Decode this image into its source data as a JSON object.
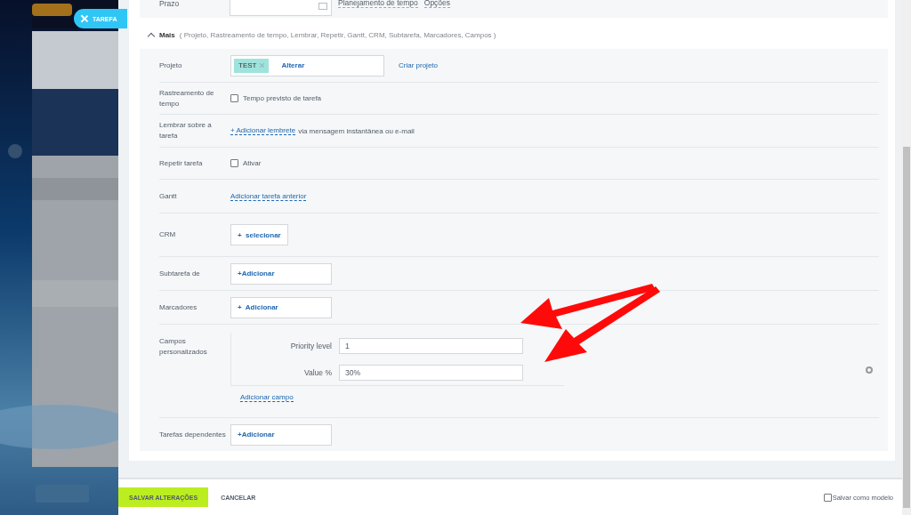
{
  "tab_button": {
    "label": "TAREFA"
  },
  "top_row": {
    "label": "Prazo",
    "links": [
      "Planejamento de tempo",
      "Opções"
    ]
  },
  "more": {
    "label": "Mais",
    "expanded": true,
    "summary": "( Projeto,  Rastreamento de tempo,  Lembrar,  Repetir,  Gantt,  CRM,  Subtarefa,  Marcadores,  Campos )"
  },
  "rows": [
    {
      "kind": "project",
      "label": "Projeto",
      "tag": "TEST",
      "action": "Alterar",
      "link": "Criar projeto"
    },
    {
      "kind": "checkbox",
      "label": "Rastreamento de tempo",
      "option": "Tempo previsto de tarefa",
      "checked": false
    },
    {
      "kind": "reminder",
      "label": "Lembrar sobre a tarefa",
      "link": "+ Adicionar lembrete",
      "text": "via mensagem instantânea ou e-mail"
    },
    {
      "kind": "checkbox",
      "label": "Repetir tarefa",
      "option": "Ativar",
      "checked": false
    },
    {
      "kind": "link",
      "label": "Gantt",
      "link": "Adicionar tarefa anterior"
    },
    {
      "kind": "selector",
      "label": "CRM",
      "button": "+  selecionar"
    },
    {
      "kind": "adder",
      "label": "Subtarefa de",
      "button": "+Adicionar"
    },
    {
      "kind": "adder",
      "label": "Marcadores",
      "button": "+  Adicionar"
    },
    {
      "kind": "fields",
      "label": "Campos personalizados",
      "fields": [
        {
          "label": "Priority level",
          "value": "1"
        },
        {
          "label": "Value %",
          "value": "30%"
        }
      ],
      "link": "Adicionar campo"
    },
    {
      "kind": "adder",
      "label": "Tarefas dependentes",
      "button": "+Adicionar"
    }
  ],
  "footer": {
    "save": "SALVAR ALTERAÇÕES",
    "cancel": "CANCELAR",
    "template": {
      "label": "Salvar como modelo",
      "checked": false
    }
  }
}
